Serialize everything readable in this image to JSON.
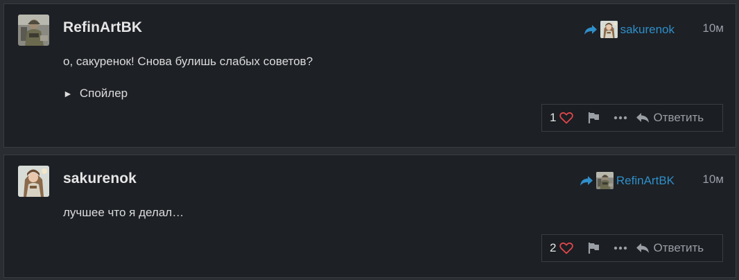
{
  "posts": [
    {
      "author": "RefinArtBK",
      "reply_to": "sakurenok",
      "time": "10м",
      "text": "о, сакуренок! Снова булишь слабых советов?",
      "spoiler_label": "Спойлер",
      "likes": "1",
      "reply_label": "Ответить"
    },
    {
      "author": "sakurenok",
      "reply_to": "RefinArtBK",
      "time": "10м",
      "text": "лучшее что я делал…",
      "likes": "2",
      "reply_label": "Ответить"
    }
  ],
  "icons": {
    "reply_to": "share-arrow-icon",
    "like": "heart-outline-icon",
    "flag": "flag-icon",
    "more": "ellipsis-icon",
    "reply": "reply-arrow-icon",
    "spoiler": "triangle-right-icon"
  },
  "colors": {
    "background": "#2a2d31",
    "card": "#1d2025",
    "link": "#2f8fc9",
    "heart": "#e0474c",
    "muted": "#9a9ea5",
    "text": "#dcdcdc"
  }
}
